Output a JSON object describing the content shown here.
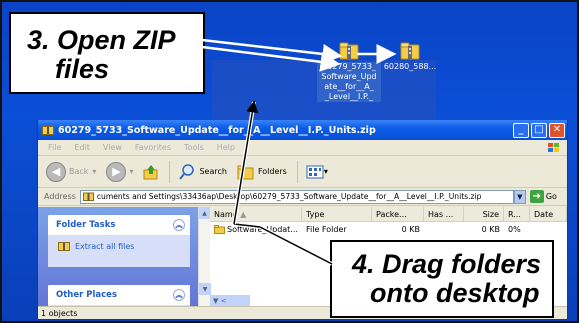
{
  "callouts": {
    "open_zip": {
      "line1": "3. Open ZIP",
      "line2": "files"
    },
    "drag_folders": {
      "line1": "4. Drag folders",
      "line2": "onto desktop"
    }
  },
  "desktop": {
    "icons": [
      {
        "label": "60279_5733_ Software_Upd ate__for__A_ _Level__I.P._",
        "selected": true,
        "icon": "zip-folder-icon"
      },
      {
        "label": "60280_588...",
        "selected": false,
        "icon": "zip-folder-icon"
      }
    ]
  },
  "window": {
    "title": "60279_5733_Software_Update__for__A__Level__I.P._Units.zip",
    "menu": [
      "File",
      "Edit",
      "View",
      "Favorites",
      "Tools",
      "Help"
    ],
    "toolbar": {
      "back": "Back",
      "search": "Search",
      "folders": "Folders"
    },
    "address": {
      "label": "Address",
      "value": "cuments and Settings\\33436ap\\Desktop\\60279_5733_Software_Update__for__A__Level__I.P._Units.zip",
      "go": "Go"
    },
    "task_pane": {
      "folder_tasks": {
        "title": "Folder Tasks",
        "items": [
          "Extract all files"
        ]
      },
      "other_places": {
        "title": "Other Places"
      }
    },
    "columns": [
      "Name",
      "Type",
      "Packe...",
      "Has ...",
      "Size",
      "R...",
      "Date"
    ],
    "rows": [
      {
        "name": "Software_Updat...",
        "type": "File Folder",
        "packed": "0 KB",
        "has": "",
        "size": "0 KB",
        "ratio": "0%",
        "date": ""
      }
    ],
    "status": "1 objects"
  },
  "colors": {
    "desktop": "#0a43c6",
    "titlebar": "#0b5de8",
    "callout_border": "#000000",
    "arrow": "#ffffff"
  }
}
